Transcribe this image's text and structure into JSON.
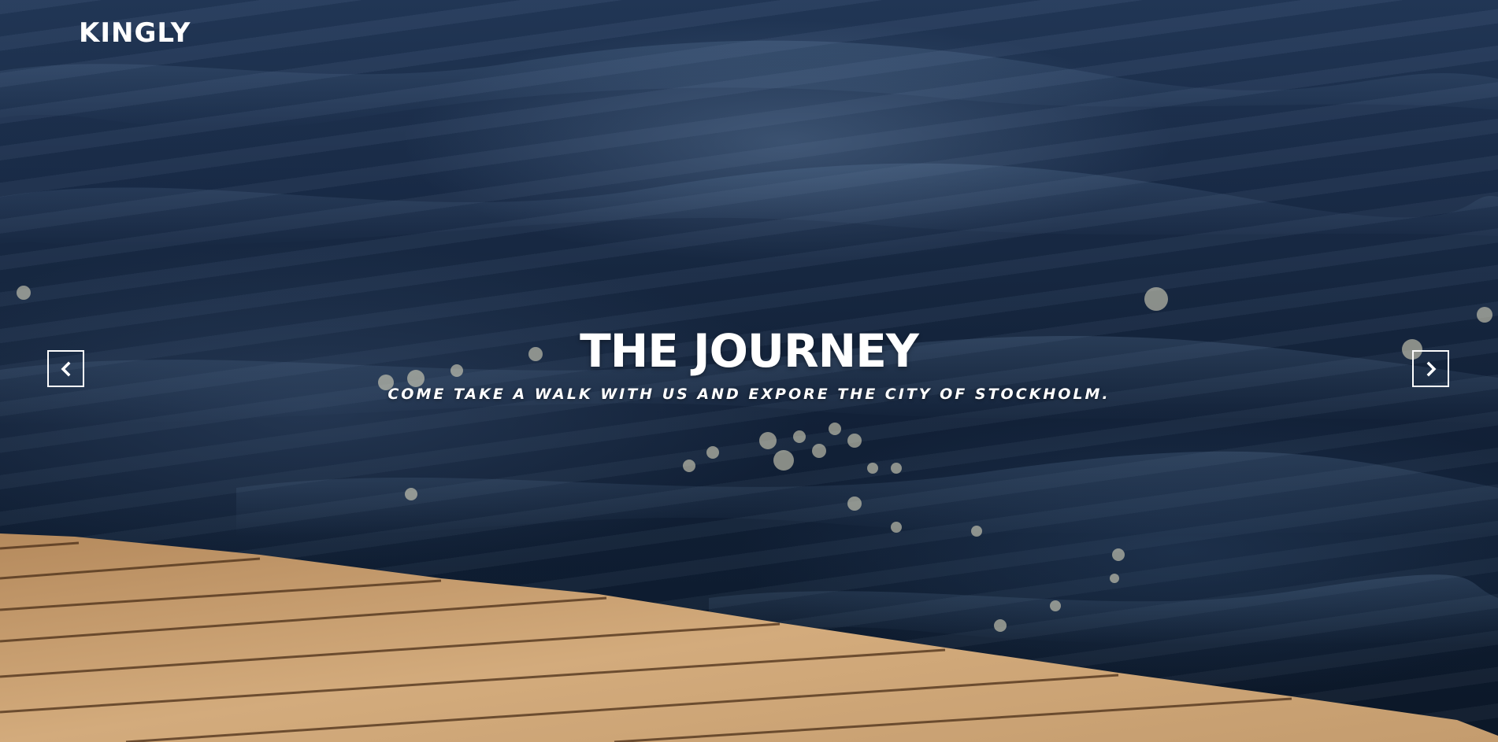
{
  "brand": {
    "name": "KINGLY"
  },
  "slide": {
    "title": "THE JOURNEY",
    "subtitle": "COME TAKE A WALK WITH US AND EXPORE THE CITY OF STOCKHOLM."
  },
  "controls": {
    "prev_icon": "chevron-left-icon",
    "next_icon": "chevron-right-icon"
  },
  "colors": {
    "text": "#ffffff",
    "water_dark": "#0c1829",
    "water_light": "#2a4466",
    "wood": "#c99f6e"
  }
}
